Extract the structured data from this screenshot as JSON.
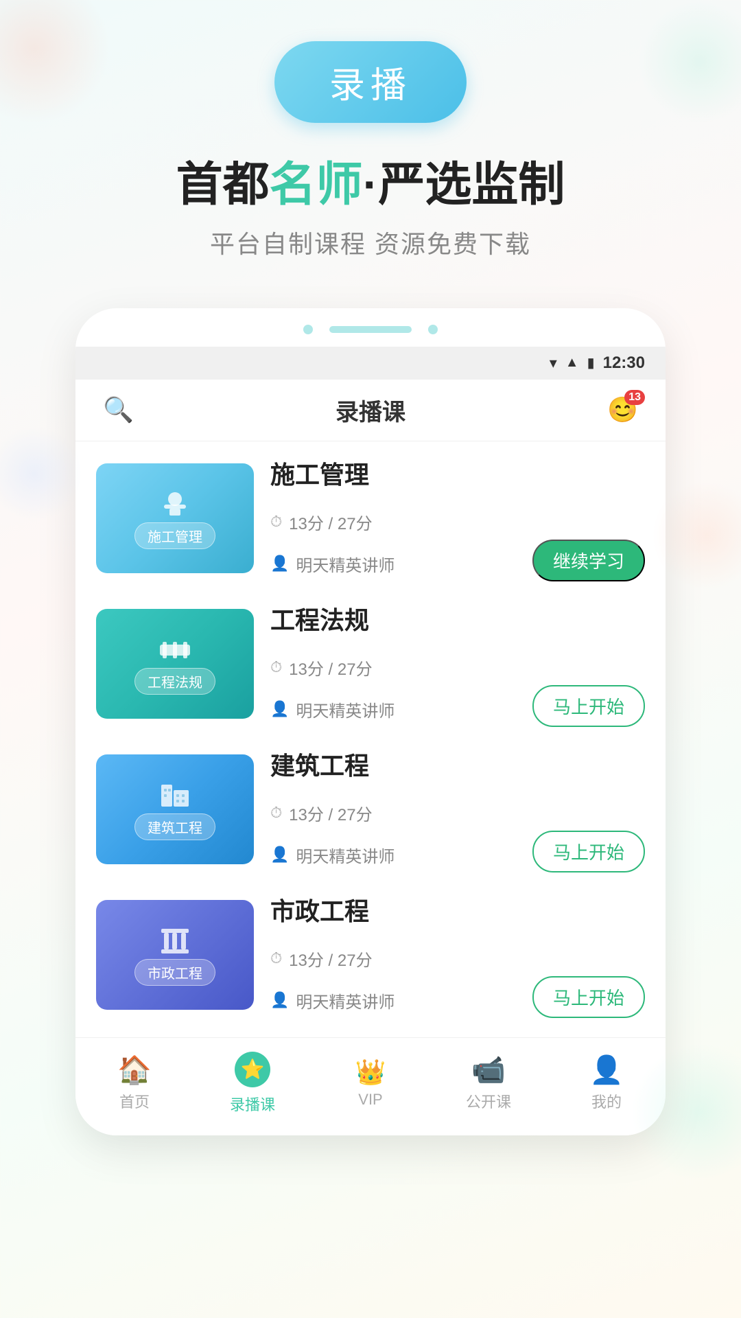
{
  "hero": {
    "record_button": "录播",
    "headline_part1": "首都",
    "headline_highlight": "名师",
    "headline_part2": "·严选监制",
    "subline": "平台自制课程  资源免费下载"
  },
  "phone": {
    "status_time": "12:30",
    "nav_title": "录播课",
    "notification_count": "13",
    "courses": [
      {
        "id": "course-1",
        "title": "施工管理",
        "thumb_label": "施工管理",
        "thumb_class": "thumb-施工管理",
        "thumb_icon": "👷",
        "duration": "13分 / 27分",
        "teacher": "明天精英讲师",
        "action": "继续学习",
        "action_type": "continue"
      },
      {
        "id": "course-2",
        "title": "工程法规",
        "thumb_label": "工程法规",
        "thumb_class": "thumb-工程法规",
        "thumb_icon": "🚧",
        "duration": "13分 / 27分",
        "teacher": "明天精英讲师",
        "action": "马上开始",
        "action_type": "start"
      },
      {
        "id": "course-3",
        "title": "建筑工程",
        "thumb_label": "建筑工程",
        "thumb_class": "thumb-建筑工程",
        "thumb_icon": "🏗",
        "duration": "13分 / 27分",
        "teacher": "明天精英讲师",
        "action": "马上开始",
        "action_type": "start"
      },
      {
        "id": "course-4",
        "title": "市政工程",
        "thumb_label": "市政工程",
        "thumb_class": "thumb-市政工程",
        "thumb_icon": "🏛",
        "duration": "13分 / 27分",
        "teacher": "明天精英讲师",
        "action": "马上开始",
        "action_type": "start"
      }
    ]
  },
  "bottom_nav": [
    {
      "id": "nav-home",
      "label": "首页",
      "icon": "🏠",
      "active": false
    },
    {
      "id": "nav-record",
      "label": "录播课",
      "icon": "⭐",
      "active": true
    },
    {
      "id": "nav-vip",
      "label": "VIP",
      "icon": "👑",
      "active": false
    },
    {
      "id": "nav-live",
      "label": "公开课",
      "icon": "📹",
      "active": false
    },
    {
      "id": "nav-mine",
      "label": "我的",
      "icon": "👤",
      "active": false
    }
  ]
}
